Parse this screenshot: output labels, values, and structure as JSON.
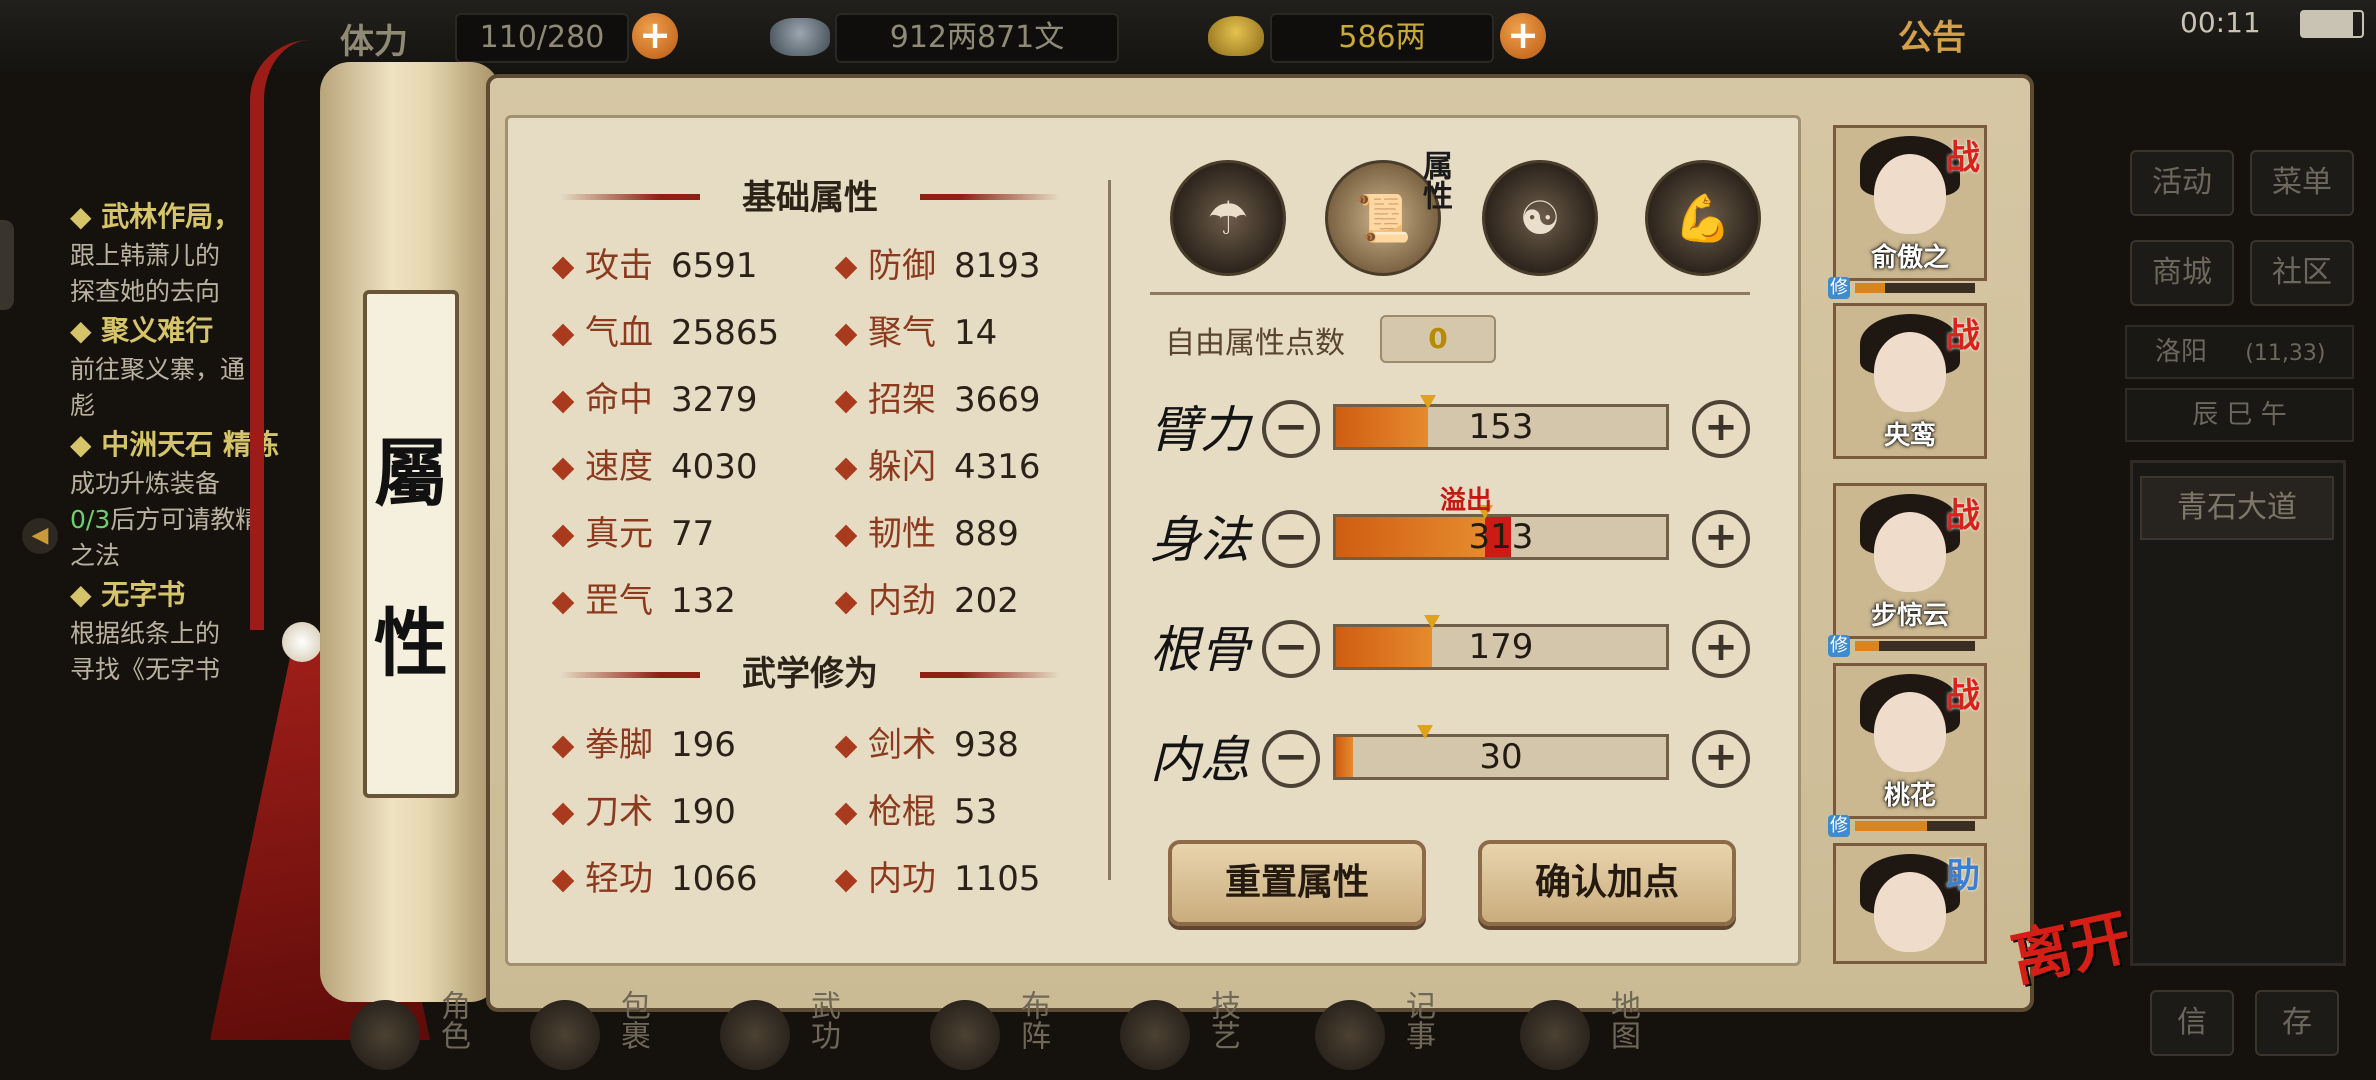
{
  "topbar": {
    "stamina_label": "体力",
    "stamina": "110/280",
    "money": "912两871文",
    "gold": "586两",
    "notice": "公告",
    "clock": "00:11"
  },
  "quests": [
    {
      "title": "武林作局，",
      "desc": "跟上韩萧儿的\n探查她的去向"
    },
    {
      "title": "聚义难行",
      "desc": "前往聚义寨，通\n彪"
    },
    {
      "title": "中洲天石 精炼",
      "desc": "成功升炼装备\n0/3后方可请教精\n之法",
      "highlight": "0/3"
    },
    {
      "title": "无字书",
      "desc": "根据纸条上的\n寻找《无字书"
    }
  ],
  "scroll": {
    "char1": "屬",
    "char2": "性"
  },
  "basic": {
    "title": "基础属性",
    "stats": [
      {
        "name": "攻击",
        "value": "6591"
      },
      {
        "name": "防御",
        "value": "8193"
      },
      {
        "name": "气血",
        "value": "25865"
      },
      {
        "name": "聚气",
        "value": "14"
      },
      {
        "name": "命中",
        "value": "3279"
      },
      {
        "name": "招架",
        "value": "3669"
      },
      {
        "name": "速度",
        "value": "4030"
      },
      {
        "name": "躲闪",
        "value": "4316"
      },
      {
        "name": "真元",
        "value": "77"
      },
      {
        "name": "韧性",
        "value": "889"
      },
      {
        "name": "罡气",
        "value": "132"
      },
      {
        "name": "内劲",
        "value": "202"
      }
    ]
  },
  "martial": {
    "title": "武学修为",
    "stats": [
      {
        "name": "拳脚",
        "value": "196"
      },
      {
        "name": "剑术",
        "value": "938"
      },
      {
        "name": "刀术",
        "value": "190"
      },
      {
        "name": "枪棍",
        "value": "53"
      },
      {
        "name": "轻功",
        "value": "1066"
      },
      {
        "name": "内功",
        "value": "1105"
      }
    ]
  },
  "tabs": {
    "active_badge": "属性"
  },
  "free_points": {
    "label": "自由属性点数",
    "value": "0"
  },
  "attributes": [
    {
      "label": "臂力",
      "value": "153",
      "fill": 0.28
    },
    {
      "label": "身法",
      "value": "313",
      "fill": 0.45,
      "overflow": true,
      "overflow_label": "溢出"
    },
    {
      "label": "根骨",
      "value": "179",
      "fill": 0.29
    },
    {
      "label": "内息",
      "value": "30",
      "fill": 0.05
    }
  ],
  "buttons": {
    "reset": "重置属性",
    "confirm": "确认加点"
  },
  "party": [
    {
      "name": "俞傲之",
      "tag": "战",
      "xiu": "修",
      "progress": 0.25
    },
    {
      "name": "央鸾",
      "tag": "战"
    },
    {
      "name": "步惊云",
      "tag": "战",
      "xiu": "修",
      "progress": 0.2
    },
    {
      "name": "桃花",
      "tag": "战",
      "xiu": "修",
      "progress": 0.6
    },
    {
      "name": "",
      "tag": "助"
    }
  ],
  "leave": "离开",
  "right_menu": {
    "activity": "活动",
    "menu": "菜单",
    "shop": "商城",
    "community": "社区",
    "location": "洛阳",
    "coords": "(11,33)",
    "time": "辰 巳 午",
    "road": "青石大道",
    "b1": "信",
    "b2": "存"
  },
  "bottom_menu": [
    "角色",
    "包裹",
    "武功",
    "布阵",
    "技艺",
    "记事",
    "地图"
  ],
  "colors": {
    "accent_red": "#8d1f13",
    "bar_orange": "#e68b2d",
    "overflow_red": "#cc1b14"
  }
}
